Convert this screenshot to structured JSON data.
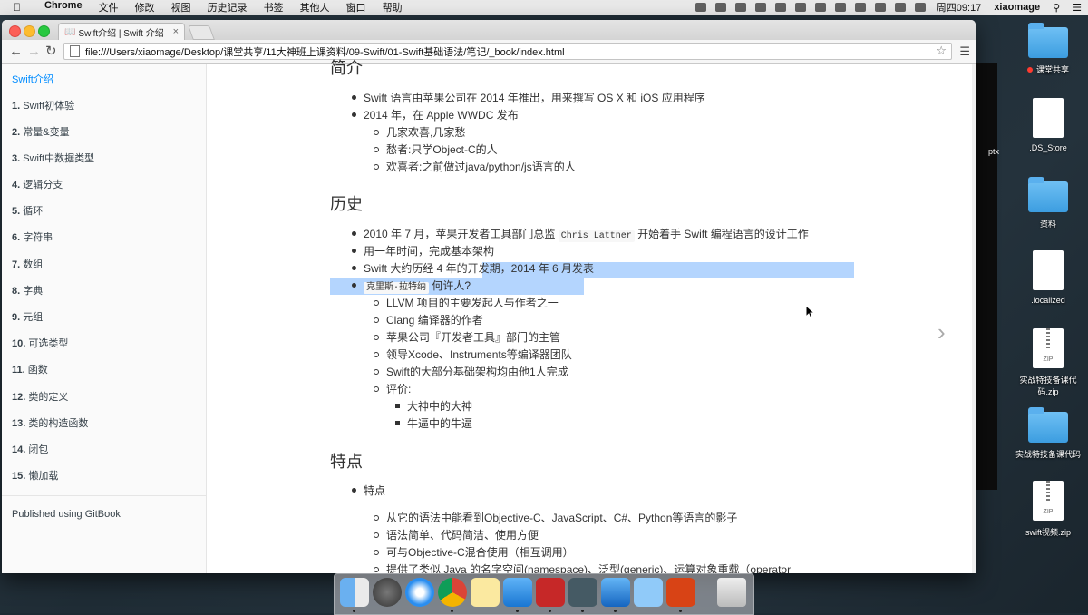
{
  "menubar": {
    "app": "Chrome",
    "menus": [
      "文件",
      "修改",
      "视图",
      "历史记录",
      "书签",
      "其他人",
      "窗口",
      "帮助"
    ],
    "clock": "周四09:17",
    "user": "xiaomage"
  },
  "browser": {
    "tab_title": "Swift介绍 | Swift 介绍",
    "url": "file:///Users/xiaomage/Desktop/课堂共享/11大神班上课资料/09-Swift/01-Swift基础语法/笔记/_book/index.html"
  },
  "sidebar": {
    "items": [
      {
        "num": "",
        "label": "Swift介绍"
      },
      {
        "num": "1.",
        "label": "Swift初体验"
      },
      {
        "num": "2.",
        "label": "常量&变量"
      },
      {
        "num": "3.",
        "label": "Swift中数据类型"
      },
      {
        "num": "4.",
        "label": "逻辑分支"
      },
      {
        "num": "5.",
        "label": "循环"
      },
      {
        "num": "6.",
        "label": "字符串"
      },
      {
        "num": "7.",
        "label": "数组"
      },
      {
        "num": "8.",
        "label": "字典"
      },
      {
        "num": "9.",
        "label": "元组"
      },
      {
        "num": "10.",
        "label": "可选类型"
      },
      {
        "num": "11.",
        "label": "函数"
      },
      {
        "num": "12.",
        "label": "类的定义"
      },
      {
        "num": "13.",
        "label": "类的构造函数"
      },
      {
        "num": "14.",
        "label": "闭包"
      },
      {
        "num": "15.",
        "label": "懒加载"
      }
    ],
    "published": "Published using GitBook"
  },
  "content": {
    "h_intro": "简介",
    "intro": [
      "Swift 语言由苹果公司在 2014 年推出，用来撰写 OS X 和 iOS 应用程序",
      "2014 年，在 Apple WWDC 发布"
    ],
    "intro_sub": [
      "几家欢喜,几家愁",
      "愁者:只学Object-C的人",
      "欢喜者:之前做过java/python/js语言的人"
    ],
    "h_history": "历史",
    "history_1_pre": "2010 年 7 月，苹果开发者工具部门总监",
    "history_1_code": "Chris Lattner",
    "history_1_post": "开始着手 Swift 编程语言的设计工作",
    "history_2": "用一年时间，完成基本架构",
    "history_3": "Swift 大约历经 4 年的开发期，2014 年 6 月发表",
    "history_4_code": "克里斯·拉特纳",
    "history_4_post": "何许人?",
    "history_sub": [
      "LLVM 项目的主要发起人与作者之一",
      "Clang 编译器的作者",
      "苹果公司『开发者工具』部门的主管",
      "领导Xcode、Instruments等编译器团队",
      "Swift的大部分基础架构均由他1人完成",
      "评价:"
    ],
    "history_eval": [
      "大神中的大神",
      "牛逼中的牛逼"
    ],
    "h_features": "特点",
    "features": "特点",
    "features_sub": [
      "从它的语法中能看到Objective-C、JavaScript、C#、Python等语言的影子",
      "语法简单、代码简洁、使用方便",
      "可与Objective-C混合使用（相互调用）",
      "提供了类似 Java 的名字空间(namespace)、泛型(generic)、运算对象重载（operator"
    ]
  },
  "desktop": {
    "icons": [
      "课堂共享",
      ".DS_Store",
      "资料",
      ".localized",
      "实战特技备课代码.zip",
      "实战特技备课代码",
      "swift视频.zip"
    ],
    "partial_label": "ptx",
    "zip_label": "ZIP"
  }
}
